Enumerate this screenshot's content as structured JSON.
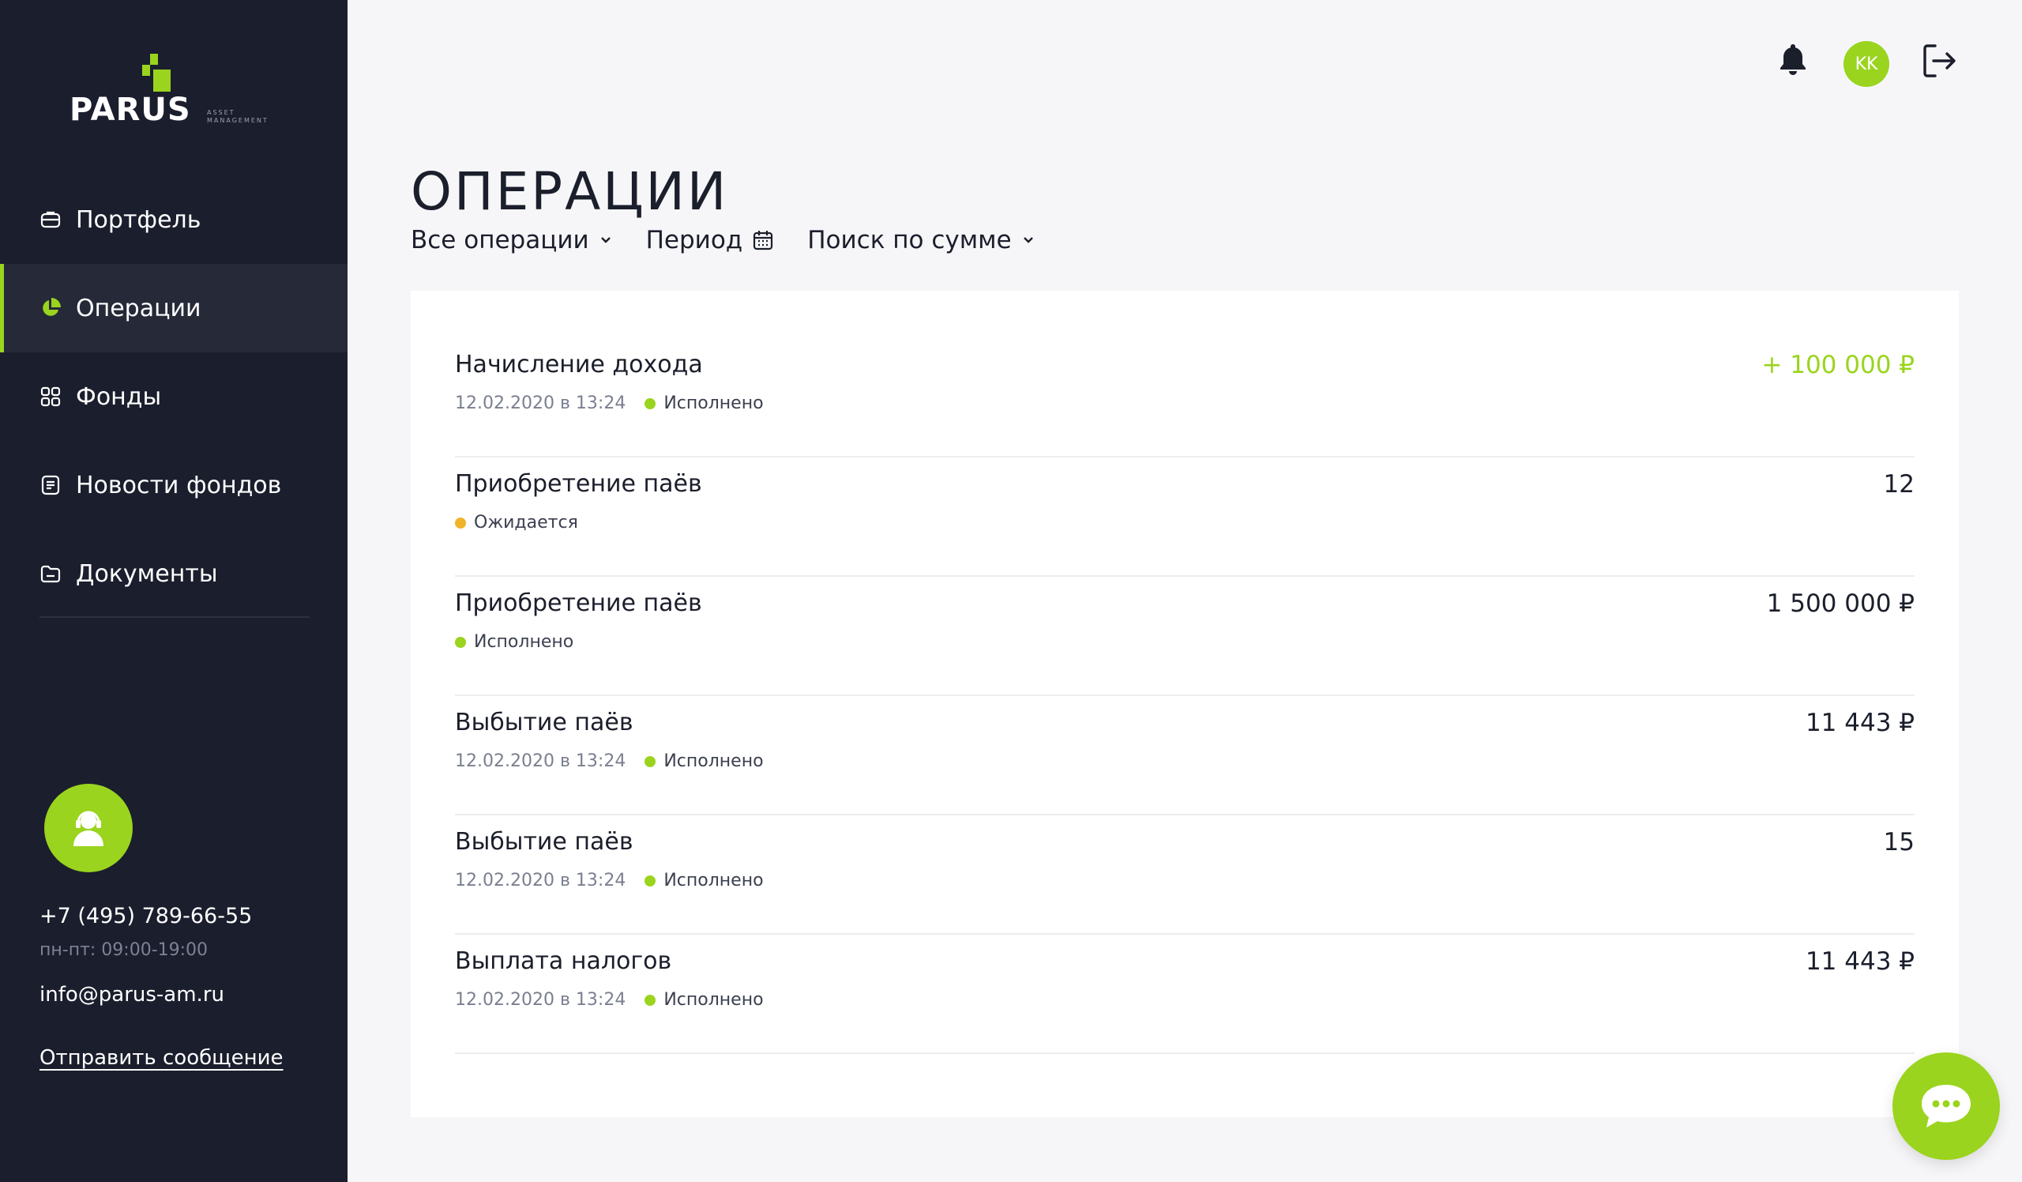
{
  "brand": {
    "name": "PARUS",
    "subtitle_line1": "ASSET",
    "subtitle_line2": "MANAGEMENT",
    "accent": "#9ad41e",
    "sidebar_bg": "#1b1e2d"
  },
  "sidebar": {
    "items": [
      {
        "label": "Портфель",
        "icon": "briefcase-icon",
        "active": false
      },
      {
        "label": "Операции",
        "icon": "pie-chart-icon",
        "active": true
      },
      {
        "label": "Фонды",
        "icon": "grid-icon",
        "active": false
      },
      {
        "label": "Новости фондов",
        "icon": "news-icon",
        "active": false
      },
      {
        "label": "Документы",
        "icon": "folder-icon",
        "active": false
      }
    ],
    "support": {
      "avatar_icon": "support-agent-icon",
      "phone": "+7 (495) 789-66-55",
      "hours": "пн-пт: 09:00-19:00",
      "email": "info@parus-am.ru",
      "send_message": "Отправить сообщение"
    }
  },
  "header": {
    "bell_icon": "bell-icon",
    "user_initials": "KK",
    "logout_icon": "logout-icon"
  },
  "main": {
    "title": "ОПЕРАЦИИ",
    "filters": {
      "operations": "Все операции",
      "period": "Период",
      "amount_search": "Поиск по сумме"
    },
    "operations": [
      {
        "title": "Начисление дохода",
        "date": "12.02.2020 в 13:24",
        "status": "Исполнено",
        "status_color": "#9ad41e",
        "amount": "+ 100 000 ₽",
        "positive": true
      },
      {
        "title": "Приобретение паёв",
        "date": "",
        "status": "Ожидается",
        "status_color": "#f0b429",
        "amount": "12",
        "positive": false
      },
      {
        "title": "Приобретение паёв",
        "date": "",
        "status": "Исполнено",
        "status_color": "#9ad41e",
        "amount": "1 500 000 ₽",
        "positive": false
      },
      {
        "title": "Выбытие паёв",
        "date": "12.02.2020 в 13:24",
        "status": "Исполнено",
        "status_color": "#9ad41e",
        "amount": "11 443 ₽",
        "positive": false
      },
      {
        "title": "Выбытие паёв",
        "date": "12.02.2020 в 13:24",
        "status": "Исполнено",
        "status_color": "#9ad41e",
        "amount": "15",
        "positive": false
      },
      {
        "title": "Выплата налогов",
        "date": "12.02.2020 в 13:24",
        "status": "Исполнено",
        "status_color": "#9ad41e",
        "amount": "11 443 ₽",
        "positive": false
      }
    ]
  },
  "chat": {
    "icon": "chat-bubble-icon"
  }
}
